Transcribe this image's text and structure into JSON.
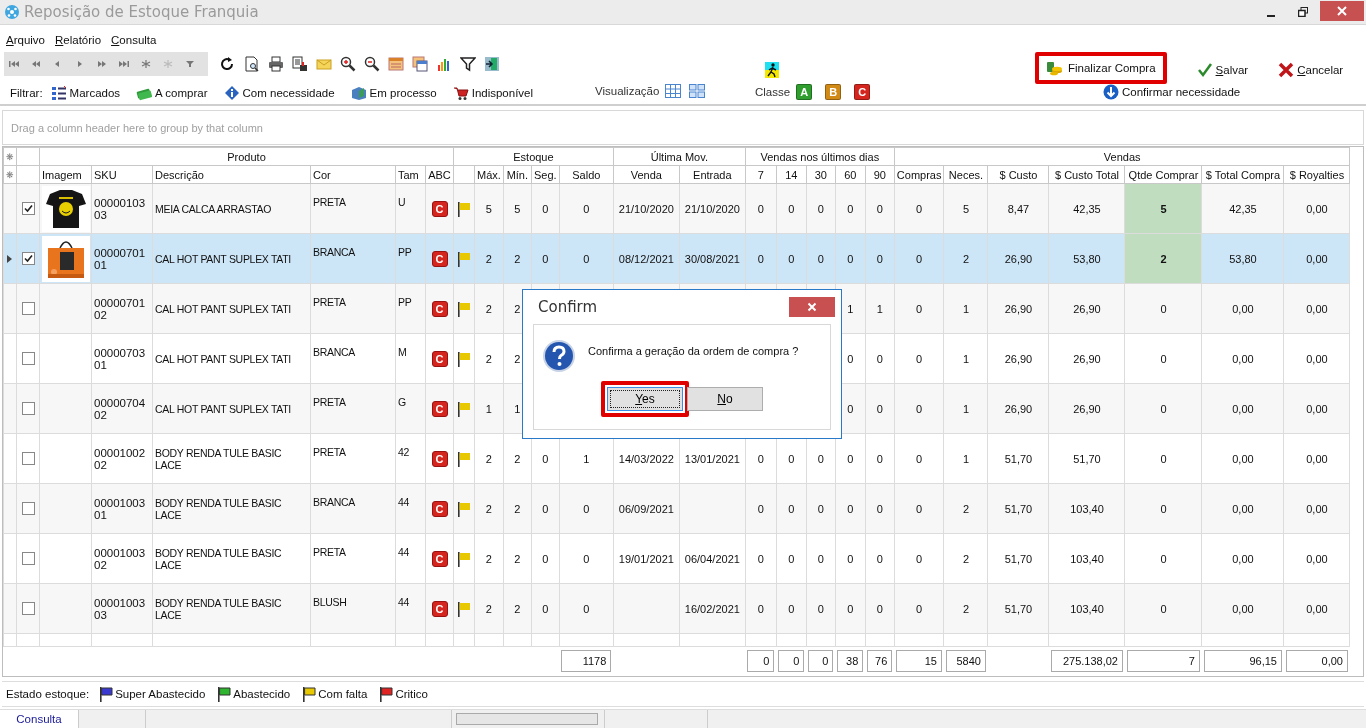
{
  "window": {
    "title": "Reposição de Estoque Franquia"
  },
  "menu": [
    "Arquivo",
    "Relatório",
    "Consulta"
  ],
  "filter_bar": {
    "label": "Filtrar:",
    "items": [
      {
        "label": "Marcados"
      },
      {
        "label": "A comprar"
      },
      {
        "label": "Com necessidade"
      },
      {
        "label": "Em processo"
      },
      {
        "label": "Indisponível"
      }
    ]
  },
  "view": {
    "label": "Visualização"
  },
  "classes": {
    "label": "Classe",
    "items": [
      {
        "label": "A",
        "color": "#2f9e2f"
      },
      {
        "label": "B",
        "color": "#d18a16"
      },
      {
        "label": "C",
        "color": "#d4261e"
      }
    ]
  },
  "actions": {
    "finalize": {
      "label": "Finalizar Compra",
      "highlighted": true
    },
    "save": "Salvar",
    "cancel": "Cancelar",
    "confirm_need": "Confirmar necessidade"
  },
  "group_panel": {
    "placeholder": "Drag a column header here to group by that column"
  },
  "table": {
    "corner_marks": [
      "❋",
      "❋"
    ],
    "header_groups": [
      {
        "label": "Produto"
      },
      {
        "label": "Estoque"
      },
      {
        "label": "Última Mov."
      },
      {
        "label": "Vendas nos últimos dias"
      },
      {
        "label": "Vendas"
      }
    ],
    "columns": [
      {
        "label": "Imagem"
      },
      {
        "label": "SKU"
      },
      {
        "label": "Descrição"
      },
      {
        "label": "Cor"
      },
      {
        "label": "Tam"
      },
      {
        "label": "ABC"
      },
      {
        "kind": "flag"
      },
      {
        "label": "Máx."
      },
      {
        "label": "Mín."
      },
      {
        "label": "Seg."
      },
      {
        "label": "Saldo"
      },
      {
        "label": "Venda"
      },
      {
        "label": "Entrada"
      },
      {
        "label": "7"
      },
      {
        "label": "14"
      },
      {
        "label": "30"
      },
      {
        "label": "60"
      },
      {
        "label": "90"
      },
      {
        "label": "Compras"
      },
      {
        "label": "Neces."
      },
      {
        "label": "$ Custo"
      },
      {
        "label": "$ Custo Total"
      },
      {
        "label": "Qtde Comprar"
      },
      {
        "label": "$ Total Compra"
      },
      {
        "label": "$ Royalties"
      }
    ],
    "rows": [
      {
        "selected": false,
        "checked": true,
        "sku": "0000010303",
        "description": "MEIA CALCA ARRASTAO",
        "color_name": "PRETA",
        "size": "U",
        "abc": "C",
        "color": "#e8c800",
        "to_buy": true,
        "values": {
          "max": "5",
          "min": "5",
          "seg": "0",
          "saldo": "0",
          "venda": "21/10/2020",
          "entrada": "21/10/2020",
          "d7": "0",
          "d14": "0",
          "d30": "0",
          "d60": "0",
          "d90": "0",
          "compras": "0",
          "neces": "5",
          "custo": "8,47",
          "custo_total": "42,35",
          "qtde": "5",
          "total_compra": "42,35",
          "royalties": "0,00"
        }
      },
      {
        "selected": true,
        "checked": true,
        "sku": "0000070101",
        "description": "CAL HOT PANT SUPLEX TATI",
        "color_name": "BRANCA",
        "size": "PP",
        "abc": "C",
        "color": "#e8c800",
        "to_buy": true,
        "values": {
          "max": "2",
          "min": "2",
          "seg": "0",
          "saldo": "0",
          "venda": "08/12/2021",
          "entrada": "30/08/2021",
          "d7": "0",
          "d14": "0",
          "d30": "0",
          "d60": "0",
          "d90": "0",
          "compras": "0",
          "neces": "2",
          "custo": "26,90",
          "custo_total": "53,80",
          "qtde": "2",
          "total_compra": "53,80",
          "royalties": "0,00"
        }
      },
      {
        "selected": false,
        "checked": false,
        "sku": "0000070102",
        "description": "CAL HOT PANT SUPLEX TATI",
        "color_name": "PRETA",
        "size": "PP",
        "abc": "C",
        "color": "#e8c800",
        "to_buy": false,
        "values": {
          "max": "2",
          "min": "2",
          "d60": "1",
          "d90": "1",
          "compras": "0",
          "neces": "1",
          "custo": "26,90",
          "custo_total": "26,90",
          "qtde": "0",
          "total_compra": "0,00",
          "royalties": "0,00"
        }
      },
      {
        "selected": false,
        "checked": false,
        "sku": "0000070301",
        "description": "CAL HOT PANT SUPLEX TATI",
        "color_name": "BRANCA",
        "size": "M",
        "abc": "C",
        "color": "#e8c800",
        "to_buy": false,
        "values": {
          "max": "2",
          "min": "2",
          "d60": "0",
          "d90": "0",
          "compras": "0",
          "neces": "1",
          "custo": "26,90",
          "custo_total": "26,90",
          "qtde": "0",
          "total_compra": "0,00",
          "royalties": "0,00"
        }
      },
      {
        "selected": false,
        "checked": false,
        "sku": "0000070402",
        "description": "CAL HOT PANT SUPLEX TATI",
        "color_name": "PRETA",
        "size": "G",
        "abc": "C",
        "color": "#e8c800",
        "to_buy": false,
        "values": {
          "max": "1",
          "min": "1",
          "d60": "0",
          "d90": "0",
          "compras": "0",
          "neces": "1",
          "custo": "26,90",
          "custo_total": "26,90",
          "qtde": "0",
          "total_compra": "0,00",
          "royalties": "0,00"
        }
      },
      {
        "selected": false,
        "checked": false,
        "sku": "0000100202",
        "description": "BODY RENDA TULE BASIC LACE",
        "color_name": "PRETA",
        "size": "42",
        "abc": "C",
        "color": "#e8c800",
        "to_buy": false,
        "values": {
          "max": "2",
          "min": "2",
          "seg": "0",
          "saldo": "1",
          "venda": "14/03/2022",
          "entrada": "13/01/2021",
          "d7": "0",
          "d14": "0",
          "d30": "0",
          "d60": "0",
          "d90": "0",
          "compras": "0",
          "neces": "1",
          "custo": "51,70",
          "custo_total": "51,70",
          "qtde": "0",
          "total_compra": "0,00",
          "royalties": "0,00"
        }
      },
      {
        "selected": false,
        "checked": false,
        "sku": "0000100301",
        "description": "BODY RENDA TULE BASIC LACE",
        "color_name": "BRANCA",
        "size": "44",
        "abc": "C",
        "color": "#e8c800",
        "to_buy": false,
        "values": {
          "max": "2",
          "min": "2",
          "seg": "0",
          "saldo": "0",
          "venda": "06/09/2021",
          "d7": "0",
          "d14": "0",
          "d30": "0",
          "d60": "0",
          "d90": "0",
          "compras": "0",
          "neces": "2",
          "custo": "51,70",
          "custo_total": "103,40",
          "qtde": "0",
          "total_compra": "0,00",
          "royalties": "0,00"
        }
      },
      {
        "selected": false,
        "checked": false,
        "sku": "0000100302",
        "description": "BODY RENDA TULE BASIC LACE",
        "color_name": "PRETA",
        "size": "44",
        "abc": "C",
        "color": "#e8c800",
        "to_buy": false,
        "values": {
          "max": "2",
          "min": "2",
          "seg": "0",
          "saldo": "0",
          "venda": "19/01/2021",
          "entrada": "06/04/2021",
          "d7": "0",
          "d14": "0",
          "d30": "0",
          "d60": "0",
          "d90": "0",
          "compras": "0",
          "neces": "2",
          "custo": "51,70",
          "custo_total": "103,40",
          "qtde": "0",
          "total_compra": "0,00",
          "royalties": "0,00"
        }
      },
      {
        "selected": false,
        "checked": false,
        "sku": "0000100303",
        "description": "BODY RENDA TULE BASIC LACE",
        "color_name": "BLUSH",
        "size": "44",
        "abc": "C",
        "color": "#e8c800",
        "to_buy": false,
        "values": {
          "max": "2",
          "min": "2",
          "seg": "0",
          "saldo": "0",
          "entrada": "16/02/2021",
          "d7": "0",
          "d14": "0",
          "d30": "0",
          "d60": "0",
          "d90": "0",
          "compras": "0",
          "neces": "2",
          "custo": "51,70",
          "custo_total": "103,40",
          "qtde": "0",
          "total_compra": "0,00",
          "royalties": "0,00"
        }
      }
    ],
    "totals": {
      "saldo": "1178",
      "d7": "0",
      "d14": "0",
      "d30": "0",
      "d60": "38",
      "d90": "76",
      "compras": "15",
      "neces": "5840",
      "custo_total": "275.138,02",
      "qtde": "7",
      "total_compra": "96,15",
      "royalties": "0,00"
    }
  },
  "dialog": {
    "title": "Confirm",
    "message": "Confirma a geração da ordem de compra ?",
    "buttons": [
      {
        "label": "Yes",
        "focused": true,
        "highlighted": true
      },
      {
        "label": "No",
        "focused": false,
        "highlighted": false
      }
    ]
  },
  "legend": {
    "label": "Estado estoque:",
    "items": [
      {
        "label": "Super Abastecido",
        "color": "#3a3ad0"
      },
      {
        "label": "Abastecido",
        "color": "#2fb52f"
      },
      {
        "label": "Com falta",
        "color": "#e8c800"
      },
      {
        "label": "Critico",
        "color": "#e02424"
      }
    ]
  },
  "status_bar": {
    "tab": "Consulta",
    "progress": {
      "level": 0
    }
  }
}
